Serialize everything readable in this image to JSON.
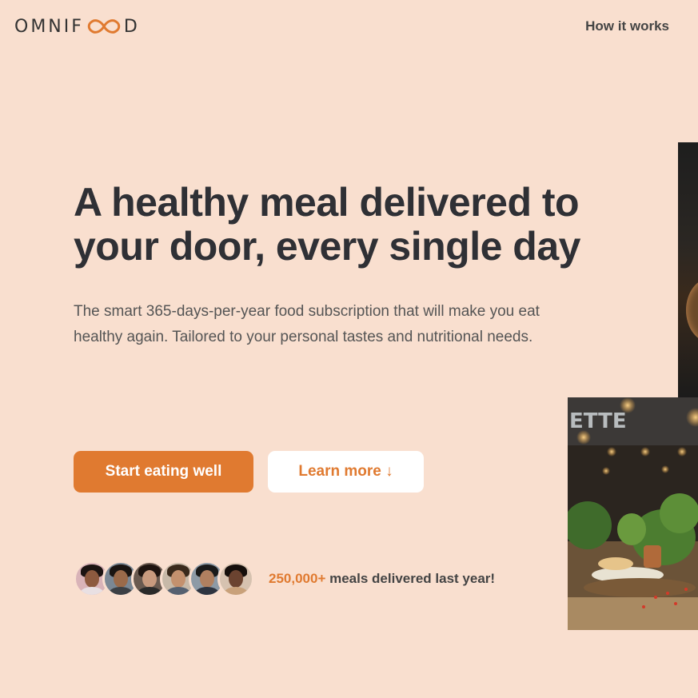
{
  "header": {
    "logo_text_left": "OMNIF",
    "logo_text_right": "D",
    "nav_link": "How it works"
  },
  "hero": {
    "heading": "A healthy meal delivered to your door, every single day",
    "description": "The smart 365-days-per-year food subscription that will make you eat healthy again. Tailored to your personal tastes and nutritional needs.",
    "primary_button": "Start eating well",
    "secondary_button": "Learn more ↓"
  },
  "social_proof": {
    "highlight": "250,000+",
    "text": " meals delivered last year!",
    "avatar_count": 6
  },
  "colors": {
    "background": "#f9dfcf",
    "accent": "#e07a30",
    "heading": "#2f3035",
    "text": "#555555"
  },
  "icons": {
    "logo_symbol": "infinity-icon",
    "learn_more_arrow": "arrow-down-icon"
  }
}
